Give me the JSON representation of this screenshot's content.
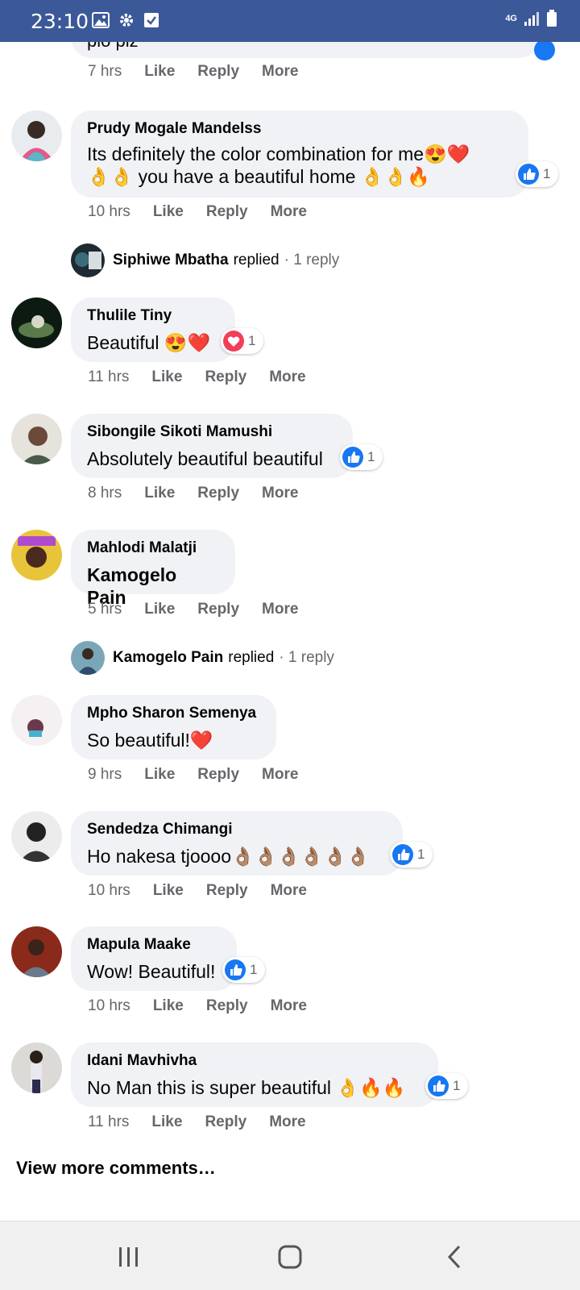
{
  "status_bar": {
    "time": "23:10",
    "network": "4G",
    "bg_color": "#3b5998"
  },
  "top_comment": {
    "partial_text": "plo plz",
    "time": "7 hrs"
  },
  "actions": {
    "like": "Like",
    "reply": "Reply",
    "more": "More"
  },
  "comments": [
    {
      "author": "Prudy Mogale Mandelss",
      "lines": [
        "Its definitely the color combination for me😍❤️",
        "👌👌 you have a beautiful home 👌👌🔥"
      ],
      "time": "10 hrs",
      "reaction": {
        "type": "like",
        "count": "1"
      }
    },
    {
      "author": "Thulile Tiny",
      "lines": [
        "Beautiful 😍❤️"
      ],
      "time": "11 hrs",
      "reaction": {
        "type": "love",
        "count": "1"
      }
    },
    {
      "author": "Sibongile Sikoti Mamushi",
      "lines": [
        "Absolutely beautiful beautiful"
      ],
      "time": "8 hrs",
      "reaction": {
        "type": "like",
        "count": "1"
      }
    },
    {
      "author": "Mahlodi Malatji",
      "lines": [
        "Kamogelo Pain"
      ],
      "time": "5 hrs",
      "reaction": null
    },
    {
      "author": "Mpho Sharon Semenya",
      "lines": [
        "So beautiful!❤️"
      ],
      "time": "9 hrs",
      "reaction": null
    },
    {
      "author": "Sendedza Chimangi",
      "lines": [
        "Ho nakesa tjoooo👌🏽👌🏽👌🏽👌🏽👌🏽👌🏽"
      ],
      "time": "10 hrs",
      "reaction": {
        "type": "like",
        "count": "1"
      }
    },
    {
      "author": "Mapula Maake",
      "lines": [
        "Wow! Beautiful!"
      ],
      "time": "10 hrs",
      "reaction": {
        "type": "like",
        "count": "1"
      }
    },
    {
      "author": "Idani Mavhivha",
      "lines": [
        "No Man this is super beautiful 👌🔥🔥"
      ],
      "time": "11 hrs",
      "reaction": {
        "type": "like",
        "count": "1"
      }
    }
  ],
  "replies": [
    {
      "name": "Siphiwe Mbatha",
      "verb": "replied",
      "count": "· 1 reply"
    },
    {
      "name": "Kamogelo Pain",
      "verb": "replied",
      "count": "· 1 reply"
    }
  ],
  "view_more": "View more comments…",
  "colors": {
    "bubble": "#f0f2f5",
    "like_blue": "#1877f2",
    "love_red": "#f33e58",
    "meta_gray": "#65676b"
  }
}
